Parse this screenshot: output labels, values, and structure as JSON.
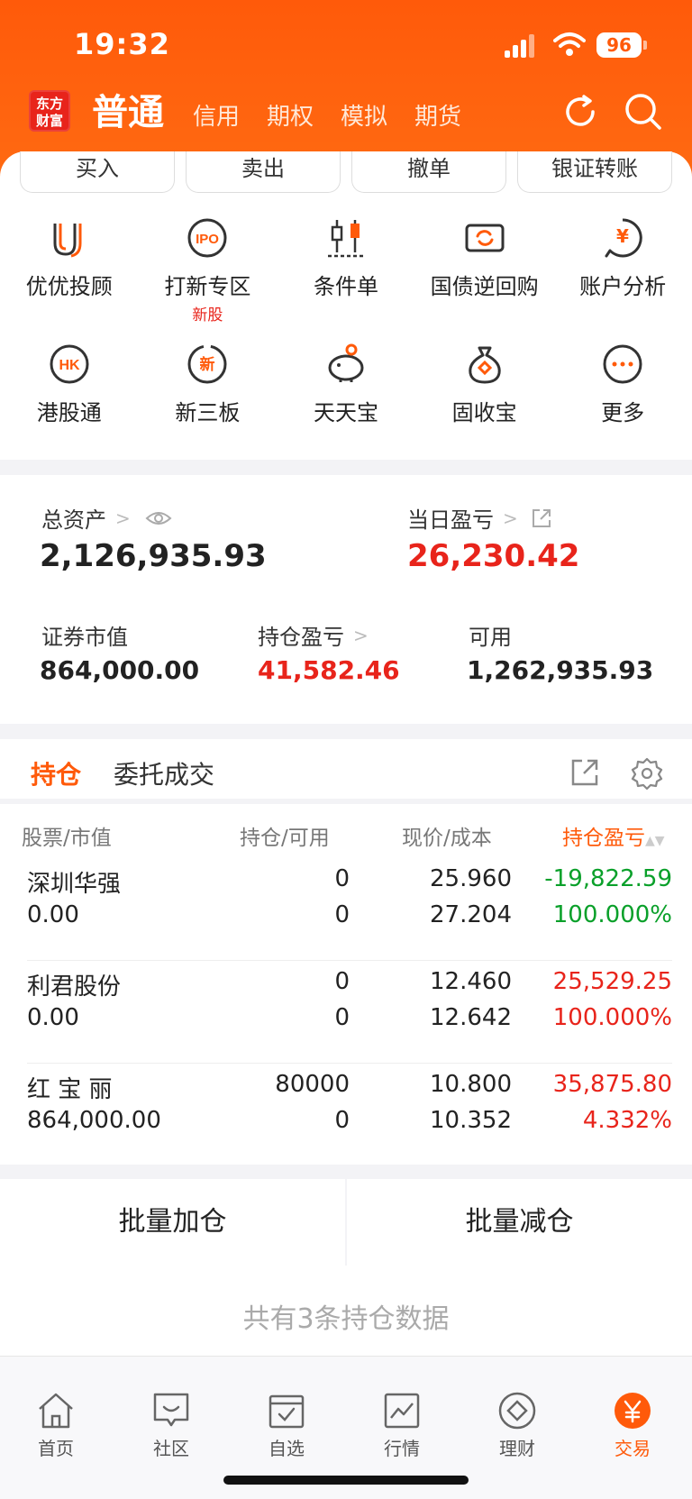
{
  "status": {
    "time": "19:32",
    "battery": "96"
  },
  "header": {
    "logo": "东方财富",
    "tabs": [
      "普通",
      "信用",
      "期权",
      "模拟",
      "期货"
    ]
  },
  "quick_buttons": [
    "买入",
    "卖出",
    "撤单",
    "银证转账"
  ],
  "grid": [
    {
      "icon": "advisor-icon",
      "label": "优优投顾",
      "sub": ""
    },
    {
      "icon": "ipo-icon",
      "label": "打新专区",
      "sub": "新股"
    },
    {
      "icon": "candlestick-icon",
      "label": "条件单",
      "sub": ""
    },
    {
      "icon": "repo-icon",
      "label": "国债逆回购",
      "sub": ""
    },
    {
      "icon": "yuan-chat-icon",
      "label": "账户分析",
      "sub": ""
    },
    {
      "icon": "hk-icon",
      "label": "港股通",
      "sub": ""
    },
    {
      "icon": "new-board-icon",
      "label": "新三板",
      "sub": ""
    },
    {
      "icon": "piggy-bank-icon",
      "label": "天天宝",
      "sub": ""
    },
    {
      "icon": "money-bag-icon",
      "label": "固收宝",
      "sub": ""
    },
    {
      "icon": "more-icon",
      "label": "更多",
      "sub": ""
    }
  ],
  "assets": {
    "total_label": "总资产",
    "total_value": "2,126,935.93",
    "daily_label": "当日盈亏",
    "daily_value": "26,230.42",
    "market_label": "证券市值",
    "market_value": "864,000.00",
    "holding_label": "持仓盈亏",
    "holding_value": "41,582.46",
    "avail_label": "可用",
    "avail_value": "1,262,935.93"
  },
  "positions": {
    "tabs": [
      "持仓",
      "委托成交"
    ],
    "headers": {
      "stock": "股票",
      "stock2": "市值",
      "pos": "持仓",
      "pos2": "可用",
      "price": "现价",
      "price2": "成本",
      "pnl": "持仓盈亏"
    },
    "rows": [
      {
        "name": "深圳华强",
        "value": "0.00",
        "hold": "0",
        "avail": "0",
        "price": "25.960",
        "cost": "27.204",
        "pnl": "-19,822.59",
        "pct": "100.000%",
        "color": "#0aa02a"
      },
      {
        "name": "利君股份",
        "value": "0.00",
        "hold": "0",
        "avail": "0",
        "price": "12.460",
        "cost": "12.642",
        "pnl": "25,529.25",
        "pct": "100.000%",
        "color": "#e8241b"
      },
      {
        "name": "红 宝 丽",
        "value": "864,000.00",
        "hold": "80000",
        "avail": "0",
        "price": "10.800",
        "cost": "10.352",
        "pnl": "35,875.80",
        "pct": "4.332%",
        "color": "#e8241b"
      }
    ]
  },
  "batch": {
    "add": "批量加仓",
    "reduce": "批量减仓"
  },
  "summary": "共有3条持仓数据",
  "tabbar": [
    {
      "icon": "home-icon",
      "label": "首页"
    },
    {
      "icon": "community-icon",
      "label": "社区"
    },
    {
      "icon": "watchlist-icon",
      "label": "自选"
    },
    {
      "icon": "market-icon",
      "label": "行情"
    },
    {
      "icon": "wealth-icon",
      "label": "理财"
    },
    {
      "icon": "trade-icon",
      "label": "交易"
    }
  ],
  "colors": {
    "brand": "#ff5a0a",
    "up": "#e8241b",
    "down": "#0aa02a"
  }
}
